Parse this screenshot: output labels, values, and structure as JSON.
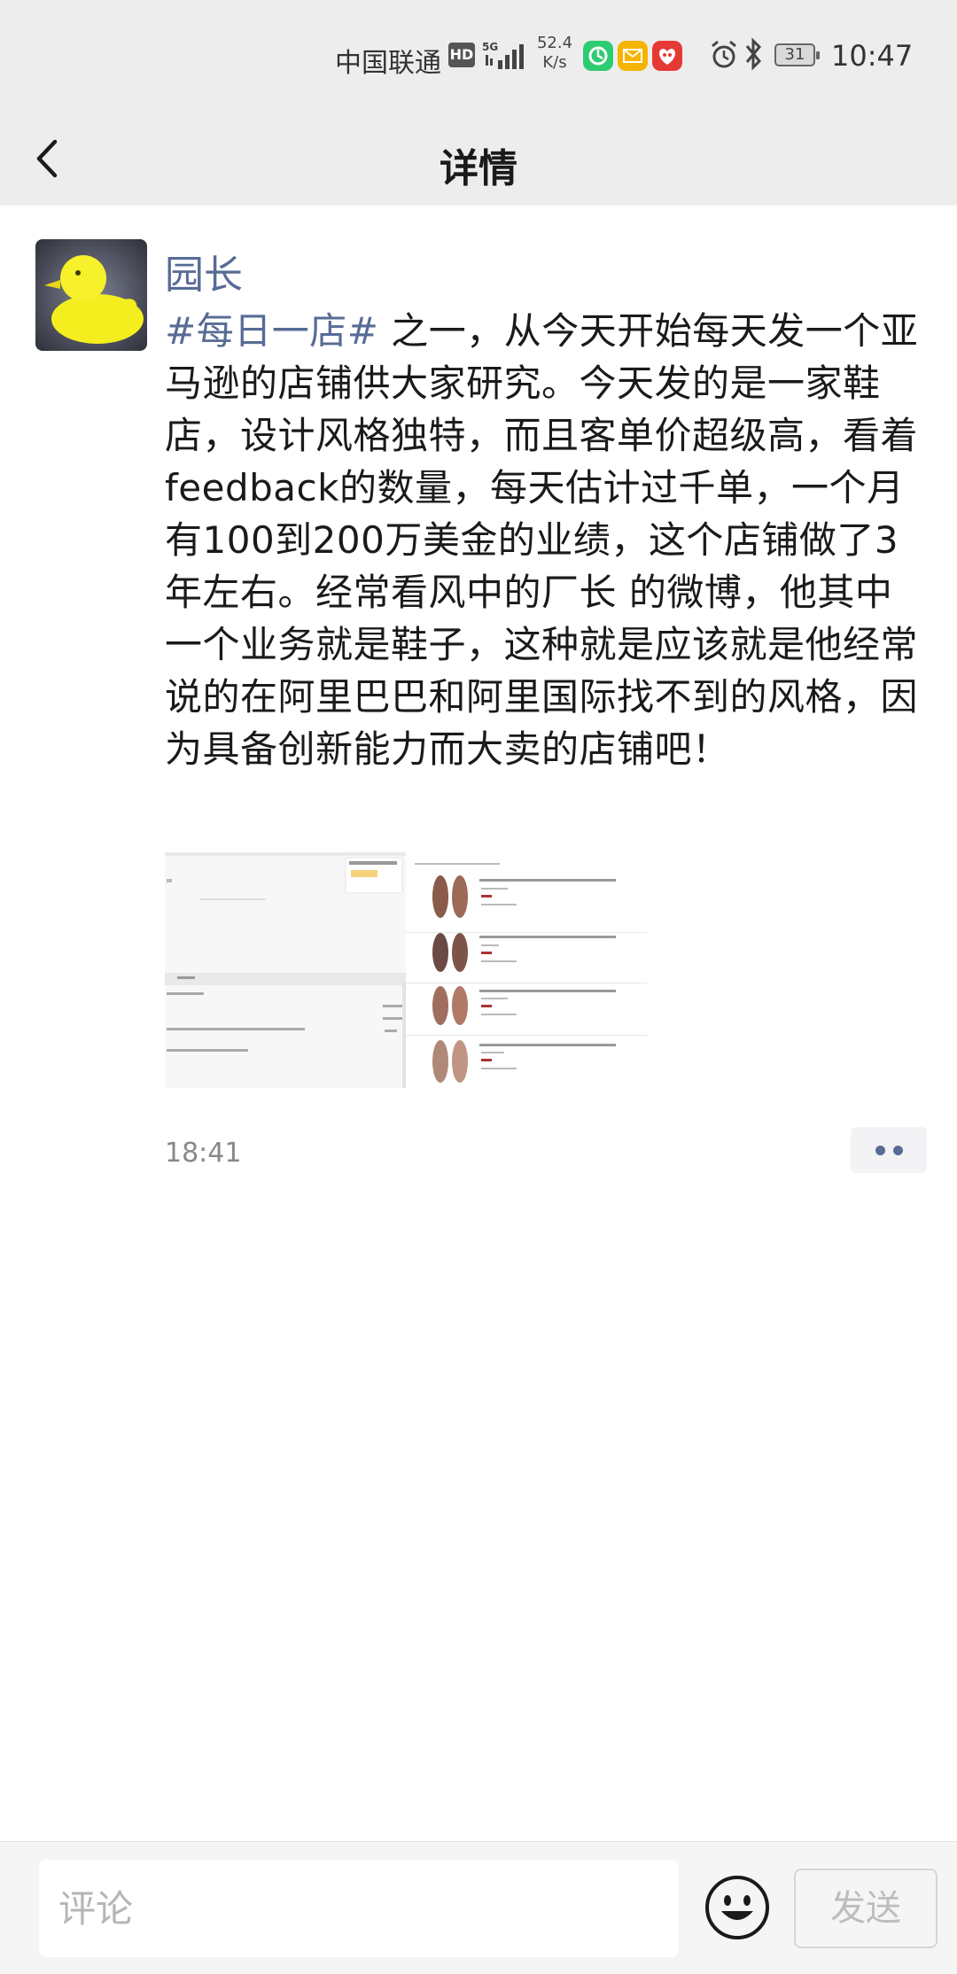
{
  "status_bar": {
    "carrier": "中国联通",
    "hd_badge": "HD",
    "speed_value": "52.4",
    "speed_unit": "K/s",
    "battery": "31",
    "time": "10:47",
    "app_icon_colors": [
      "#2ecc71",
      "#f5b400",
      "#e53935"
    ]
  },
  "nav": {
    "title": "详情"
  },
  "post": {
    "author": "园长",
    "topic": "#每日一店#",
    "text": " 之一，从今天开始每天发一个亚马逊的店铺供大家研究。今天发的是一家鞋店，设计风格独特，而且客单价超级高，看着feedback的数量，每天估计过千单，一个月有100到200万美金的业绩，这个店铺做了3年左右。经常看风中的厂长 的微博，他其中一个业务就是鞋子，这种就是应该就是他经常说的在阿里巴巴和阿里国际找不到的风格，因为具备创新能力而大卖的店铺吧！",
    "time": "18:41"
  },
  "comment_bar": {
    "placeholder": "评论",
    "send_label": "发送"
  },
  "colors": {
    "link": "#576b95",
    "header_bg": "#ededed"
  }
}
